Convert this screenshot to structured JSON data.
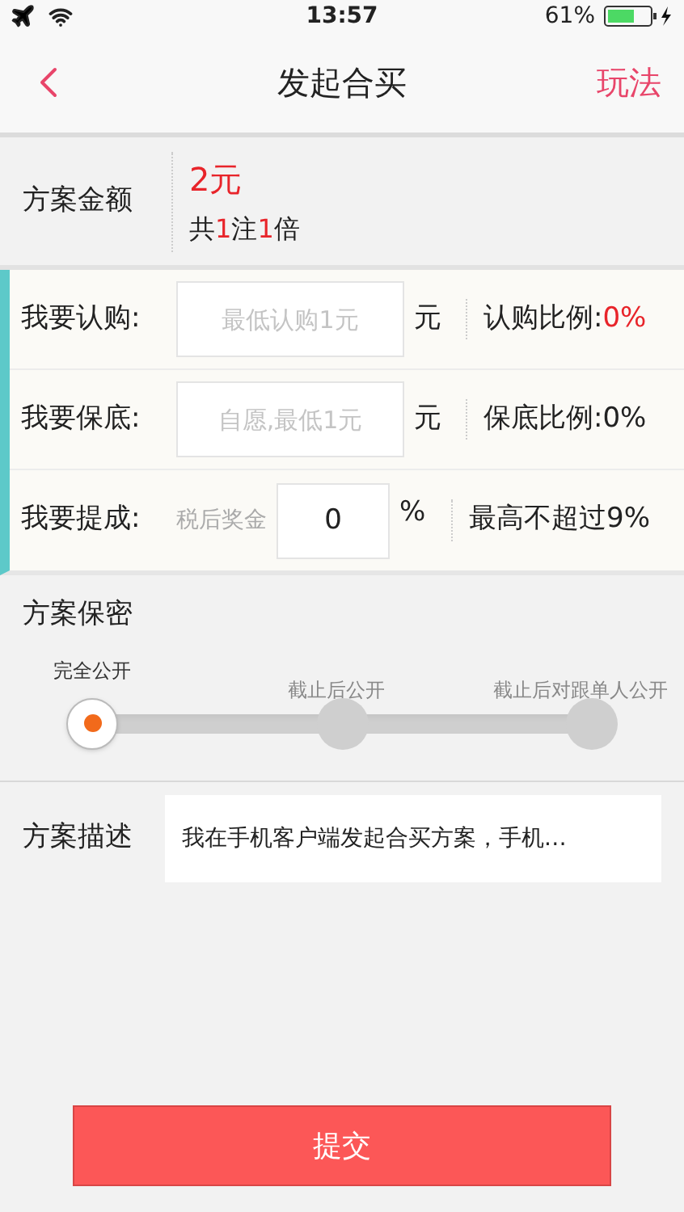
{
  "status_bar": {
    "time": "13:57",
    "battery": "61%"
  },
  "nav": {
    "title": "发起合买",
    "action": "玩法"
  },
  "amount": {
    "label": "方案金额",
    "value": "2元",
    "summary": [
      {
        "text": "共",
        "highlight": false
      },
      {
        "text": "1",
        "highlight": true
      },
      {
        "text": "注",
        "highlight": false
      },
      {
        "text": "1",
        "highlight": true
      },
      {
        "text": "倍",
        "highlight": false
      }
    ]
  },
  "form_rows": [
    {
      "kind": "amount",
      "label": "我要认购:",
      "placeholder": "最低认购1元",
      "unit": "元",
      "ratio_label": "认购比例:",
      "ratio_value": "0%",
      "highlight": true
    },
    {
      "kind": "amount",
      "label": "我要保底:",
      "placeholder": "自愿,最低1元",
      "unit": "元",
      "ratio_label": "保底比例:",
      "ratio_value": "0%",
      "highlight": false
    },
    {
      "kind": "commission",
      "label": "我要提成:",
      "hint": "税后奖金",
      "value": "0",
      "unit": "%",
      "note": "最高不超过9%"
    }
  ],
  "privacy": {
    "label": "方案保密",
    "options": [
      {
        "label": "完全公开",
        "selected": true
      },
      {
        "label": "截止后公开",
        "selected": false
      },
      {
        "label": "截止后对跟单人公开",
        "selected": false
      }
    ]
  },
  "description": {
    "label": "方案描述",
    "value": "我在手机客户端发起合买方案，手机…"
  },
  "submit": {
    "label": "提交"
  }
}
